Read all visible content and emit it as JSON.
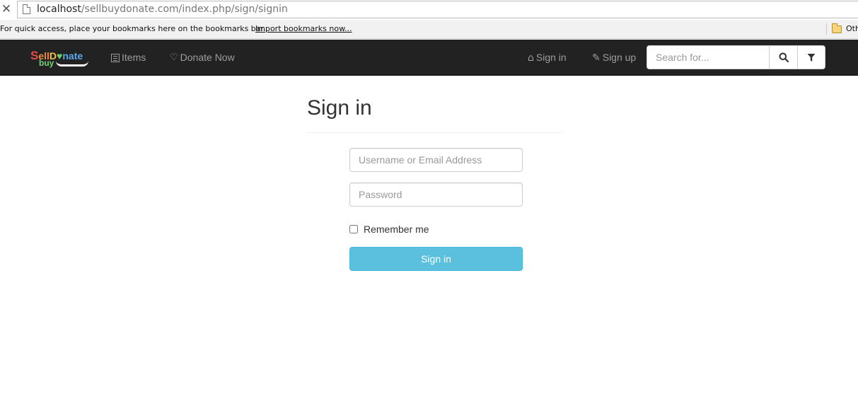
{
  "browser": {
    "url_host": "localhost",
    "url_path": "/sellbuydonate.com/index.php/sign/signin",
    "bookmarks_hint": "For quick access, place your bookmarks here on the bookmarks bar.",
    "import_link": "Import bookmarks now...",
    "other_bookmarks": "Oth"
  },
  "navbar": {
    "brand": {
      "sell_s": "S",
      "sell_rest": "ell",
      "donate_d": "D",
      "donate_heart": "♥",
      "donate_rest": "nate",
      "buy": "buy"
    },
    "items_label": "Items",
    "donate_label": "Donate Now",
    "signin_label": "Sign in",
    "signup_label": "Sign up",
    "search_placeholder": "Search for...",
    "icons": [
      "list-icon",
      "heart-icon",
      "home-icon",
      "pencil-icon",
      "search-icon",
      "filter-icon"
    ]
  },
  "main": {
    "title": "Sign in",
    "username_placeholder": "Username or Email Address",
    "password_placeholder": "Password",
    "remember_label": "Remember me",
    "remember_checked": false,
    "submit_label": "Sign in"
  },
  "colors": {
    "navbar_bg": "#222222",
    "nav_text": "#9d9d9d",
    "submit_bg": "#5bc0de"
  }
}
